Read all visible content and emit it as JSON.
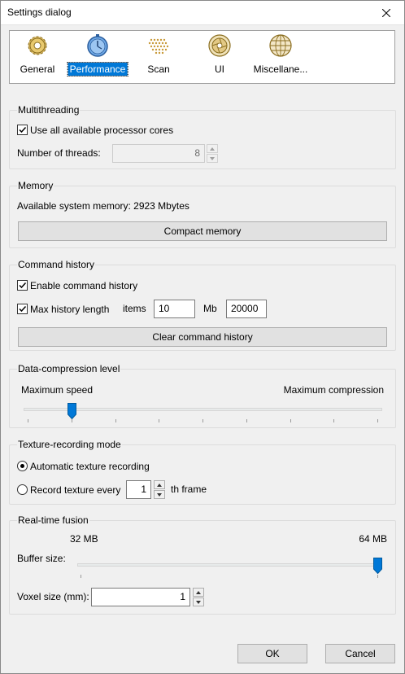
{
  "window": {
    "title": "Settings dialog"
  },
  "tabs": [
    {
      "label": "General",
      "icon": "gear-icon"
    },
    {
      "label": "Performance",
      "icon": "stopwatch-icon"
    },
    {
      "label": "Scan",
      "icon": "scan-dots-icon"
    },
    {
      "label": "UI",
      "icon": "aperture-icon"
    },
    {
      "label": "Miscellane...",
      "icon": "globe-icon"
    }
  ],
  "multithreading": {
    "title": "Multithreading",
    "use_all_label": "Use all available processor cores",
    "use_all_checked": true,
    "threads_label": "Number of threads:",
    "threads_value": "8"
  },
  "memory": {
    "title": "Memory",
    "available_text": "Available system memory: 2923 Mbytes",
    "compact_label": "Compact memory"
  },
  "history": {
    "title": "Command history",
    "enable_label": "Enable command history",
    "enable_checked": true,
    "max_label": "Max history length",
    "max_checked": true,
    "items_label": "items",
    "items_value": "10",
    "mb_label": "Mb",
    "mb_value": "20000",
    "clear_label": "Clear command history"
  },
  "compression": {
    "title": "Data-compression level",
    "min_label": "Maximum speed",
    "max_label": "Maximum compression",
    "level": 0.125
  },
  "texture": {
    "title": "Texture-recording mode",
    "auto_label": "Automatic texture recording",
    "every_label": "Record texture every",
    "every_value": "1",
    "frame_label": "th frame",
    "selected": "auto"
  },
  "fusion": {
    "title": "Real-time fusion",
    "min_label": "32 MB",
    "max_label": "64 MB",
    "buffer_label": "Buffer size:",
    "buffer_level": 1.0,
    "voxel_label": "Voxel size (mm):",
    "voxel_value": "1"
  },
  "footer": {
    "ok_label": "OK",
    "cancel_label": "Cancel"
  },
  "colors": {
    "selection": "#0078d7",
    "accent_icon": "#4a90d9"
  }
}
